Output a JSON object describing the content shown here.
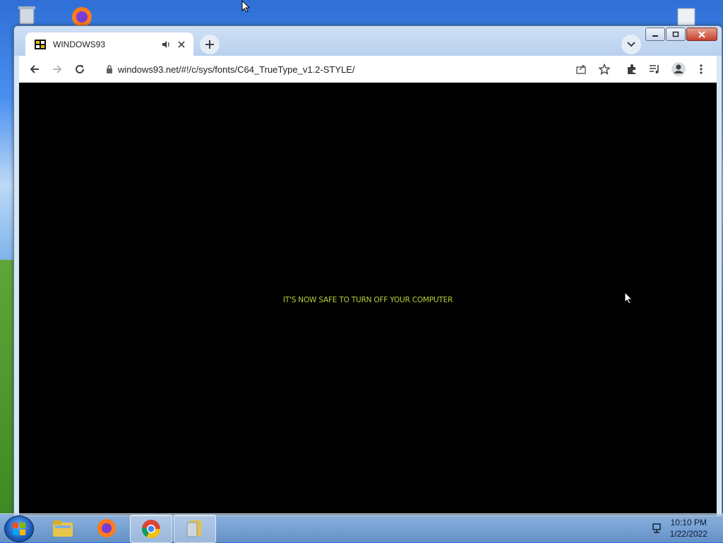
{
  "browser": {
    "tab_title": "WINDOWS93",
    "url": "windows93.net/#!/c/sys/fonts/C64_TrueType_v1.2-STYLE/"
  },
  "page": {
    "message": "IT'S NOW SAFE TO TURN OFF YOUR COMPUTER",
    "message_color": "#b6d23a",
    "background_color": "#000000"
  },
  "taskbar": {
    "time": "10:10 PM",
    "date": "1/22/2022",
    "items": [
      "file-explorer",
      "firefox",
      "chrome",
      "files"
    ]
  },
  "colors": {
    "accent": "#1a73e8"
  }
}
